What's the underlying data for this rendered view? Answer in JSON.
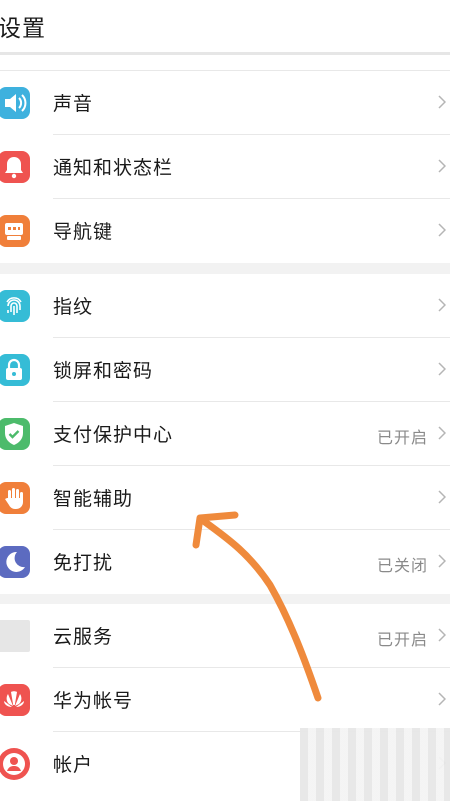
{
  "header": {
    "title": "设置"
  },
  "groups": [
    {
      "items": [
        {
          "label": "声音",
          "icon": "speaker-icon",
          "color": "#3eb1de"
        },
        {
          "label": "通知和状态栏",
          "icon": "bell-icon",
          "color": "#ef5350"
        },
        {
          "label": "导航键",
          "icon": "navigation-key-icon",
          "color": "#f07f3a"
        }
      ]
    },
    {
      "items": [
        {
          "label": "指纹",
          "icon": "fingerprint-icon",
          "color": "#35bcd6"
        },
        {
          "label": "锁屏和密码",
          "icon": "lock-icon",
          "color": "#35bcd6"
        },
        {
          "label": "支付保护中心",
          "status": "已开启",
          "icon": "shield-check-icon",
          "color": "#4cbb6b"
        },
        {
          "label": "智能辅助",
          "icon": "hand-icon",
          "color": "#f07f3a"
        },
        {
          "label": "免打扰",
          "status": "已关闭",
          "icon": "moon-icon",
          "color": "#5c6bc0"
        }
      ]
    },
    {
      "items": [
        {
          "label": "云服务",
          "status": "已开启",
          "icon": "cloud-service-icon",
          "color": "#e6e6e6"
        },
        {
          "label": "华为帐号",
          "icon": "huawei-logo-icon",
          "color": "#ef5350"
        },
        {
          "label": "帐户",
          "icon": "account-icon",
          "color": "#ef5350"
        }
      ]
    }
  ],
  "annotation": {
    "color": "#ef8a3c"
  }
}
